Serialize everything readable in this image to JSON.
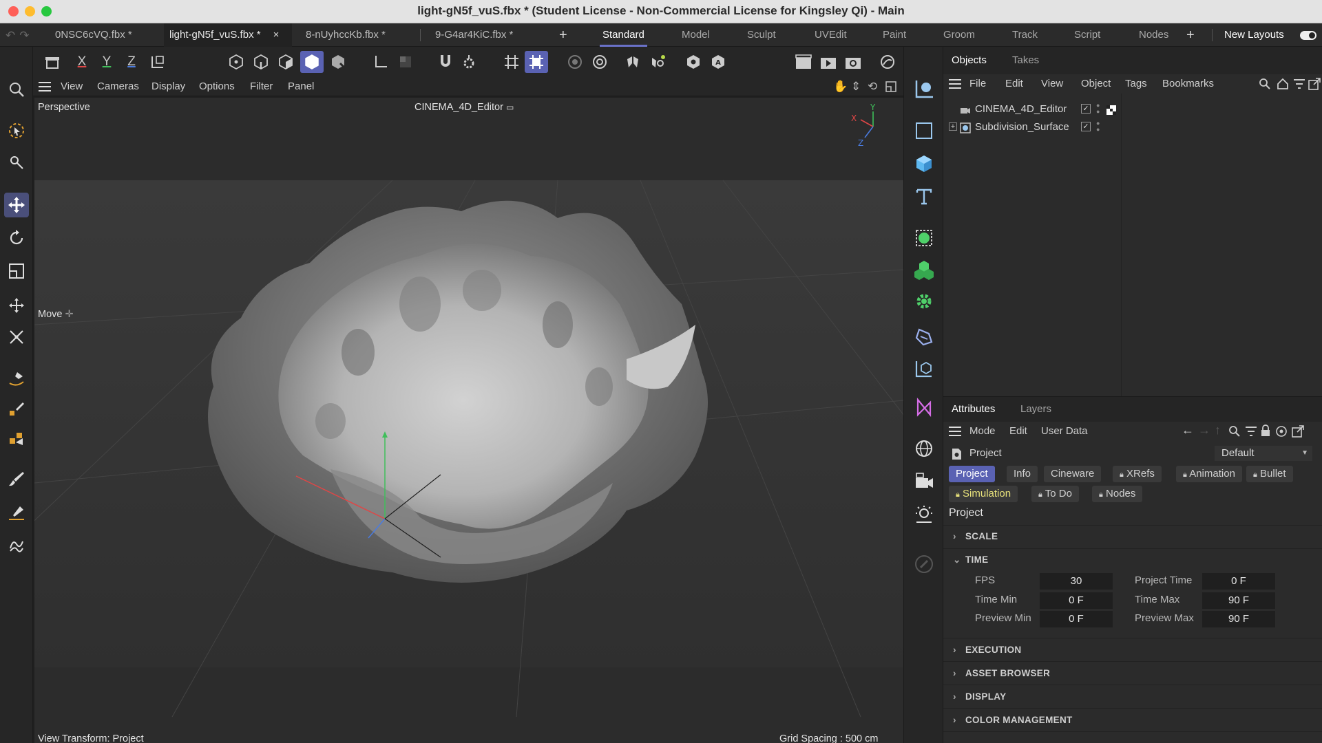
{
  "window": {
    "title": "light-gN5f_vuS.fbx * (Student License - Non-Commercial License for Kingsley Qi) - Main"
  },
  "doc_tabs": [
    {
      "label": "0NSC6cVQ.fbx *"
    },
    {
      "label": "light-gN5f_vuS.fbx *",
      "close": "×"
    },
    {
      "label": "8-nUyhccKb.fbx *"
    },
    {
      "label": "9-G4ar4KiC.fbx *"
    }
  ],
  "layouts": [
    "Standard",
    "Model",
    "Sculpt",
    "UVEdit",
    "Paint",
    "Groom",
    "Track",
    "Script",
    "Nodes"
  ],
  "new_layouts": "New Layouts",
  "top_toolbar": {
    "x": "X",
    "y": "Y",
    "z": "Z"
  },
  "viewport_menu": [
    "View",
    "Cameras",
    "Display",
    "Options",
    "Filter",
    "Panel"
  ],
  "viewport": {
    "view_name": "Perspective",
    "camera": "CINEMA_4D_Editor",
    "tool_label": "Move",
    "view_transform": "View Transform: Project",
    "grid_spacing": "Grid Spacing : 500 cm",
    "axis_x": "X",
    "axis_y": "Y",
    "axis_z": "Z"
  },
  "objects_panel": {
    "tabs": [
      "Objects",
      "Takes"
    ],
    "menu": [
      "File",
      "Edit",
      "View",
      "Object",
      "Tags",
      "Bookmarks"
    ],
    "items": [
      {
        "name": "CINEMA_4D_Editor",
        "icon": "camera-icon"
      },
      {
        "name": "Subdivision_Surface",
        "icon": "subdivision-icon"
      }
    ]
  },
  "attributes_panel": {
    "tabs": [
      "Attributes",
      "Layers"
    ],
    "menu": [
      "Mode",
      "Edit",
      "User Data"
    ],
    "object_type": "Project",
    "preset": "Default",
    "chips_row1": [
      "Project",
      "Info",
      "Cineware",
      "XRefs",
      "Animation",
      "Bullet"
    ],
    "chips_row2": [
      "Simulation",
      "To Do",
      "Nodes"
    ],
    "heading": "Project",
    "sections": {
      "scale": "SCALE",
      "time": "TIME",
      "execution": "EXECUTION",
      "asset_browser": "ASSET BROWSER",
      "display": "DISPLAY",
      "color_management": "COLOR MANAGEMENT"
    },
    "time_fields": {
      "fps_label": "FPS",
      "fps": "30",
      "project_time_label": "Project Time",
      "project_time": "0 F",
      "time_min_label": "Time Min",
      "time_min": "0 F",
      "time_max_label": "Time Max",
      "time_max": "90 F",
      "preview_min_label": "Preview Min",
      "preview_min": "0 F",
      "preview_max_label": "Preview Max",
      "preview_max": "90 F"
    }
  },
  "colors": {
    "accent": "#5a62b3",
    "simulation": "#e8e27b",
    "axis_x": "#e04646",
    "axis_y": "#3fbf5a",
    "axis_z": "#4a7be0"
  }
}
